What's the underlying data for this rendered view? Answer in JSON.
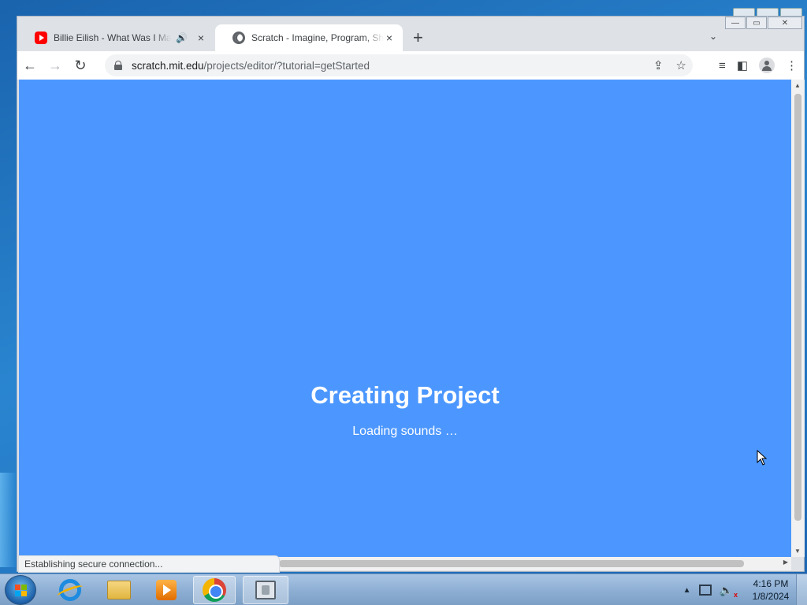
{
  "browser": {
    "tabs": [
      {
        "title": "Billie Eilish - What Was I Made For?",
        "icon": "youtube-icon",
        "audio": "🔊",
        "close": "×"
      },
      {
        "title": "Scratch - Imagine, Program, Share",
        "icon": "globe-icon",
        "close": "×"
      }
    ],
    "new_tab": "+",
    "tab_search": "⌄",
    "nav": {
      "back": "←",
      "forward": "→",
      "reload": "↻"
    },
    "url": {
      "host": "scratch.mit.edu",
      "path": "/projects/editor/?tutorial=getStarted"
    },
    "toolbar_icons": {
      "share": "⇪",
      "bookmark": "☆",
      "reading_list": "≡",
      "side_panel": "◧",
      "menu": "⋮"
    },
    "status_text": "Establishing secure connection...",
    "window_controls": {
      "minimize": "—",
      "maximize": "▭",
      "close": "✕"
    }
  },
  "page": {
    "title": "Creating Project",
    "subtitle": "Loading sounds …",
    "background_color": "#4c97ff"
  },
  "taskbar": {
    "items": [
      {
        "name": "internet-explorer",
        "icon": "ie-icon"
      },
      {
        "name": "file-explorer",
        "icon": "folder-icon"
      },
      {
        "name": "media-player",
        "icon": "media-icon"
      },
      {
        "name": "google-chrome",
        "icon": "chrome-icon",
        "active": true
      },
      {
        "name": "app",
        "icon": "app-icon"
      }
    ],
    "tray": {
      "show_hidden": "▲"
    },
    "clock": {
      "time": "4:16 PM",
      "date": "1/8/2024"
    }
  }
}
